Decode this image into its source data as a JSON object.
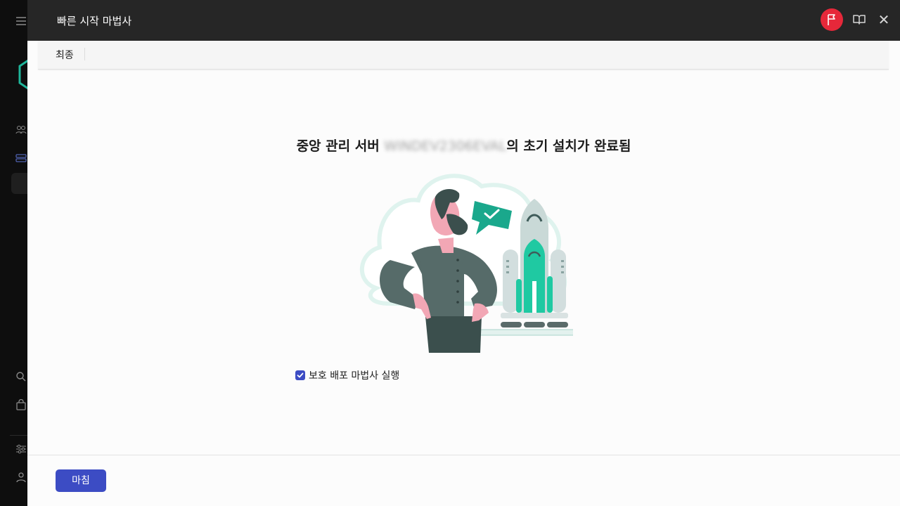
{
  "window": {
    "title": "빠른 시작 마법사"
  },
  "header_icons": {
    "help_flag": "flag-icon",
    "docs": "book-icon",
    "close": "close-icon",
    "close_glyph": "✕"
  },
  "steps": [
    {
      "label": "최종",
      "active": true
    }
  ],
  "main": {
    "heading_prefix": "중앙 관리 서버 ",
    "heading_blurred": "WINDEV2306EVAL",
    "heading_suffix": "의 초기 설치가 완료됨",
    "checkbox": {
      "label": "보호 배포 마법사 실행",
      "checked": true
    }
  },
  "footer": {
    "finish_label": "마침"
  },
  "colors": {
    "accent": "#3c4cc4",
    "flag": "#e6283a",
    "teal": "#1fc9a2",
    "topbar": "#262626"
  }
}
